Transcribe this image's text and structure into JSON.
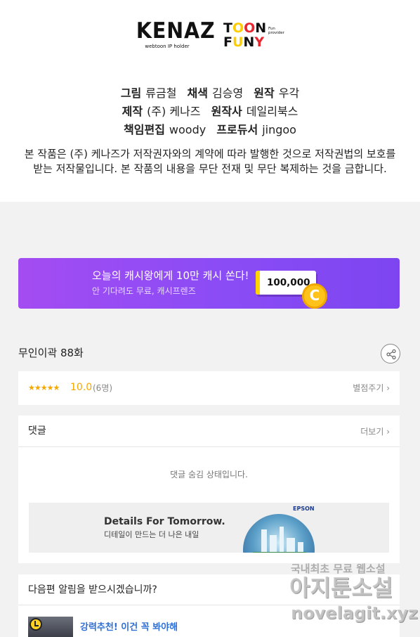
{
  "logos": {
    "kenaz": {
      "name": "KENAZ",
      "tagline": "webtoon IP holder"
    },
    "toonfuny": {
      "row1": "TOON",
      "row2": "FUNY",
      "tagline": "Fun provider"
    }
  },
  "credits": {
    "line1": [
      {
        "key": "그림",
        "value": "류금철"
      },
      {
        "key": "채색",
        "value": "김승영"
      },
      {
        "key": "원작",
        "value": "우각"
      }
    ],
    "line2": [
      {
        "key": "제작",
        "value": "(주) 케나즈"
      },
      {
        "key": "원작사",
        "value": "데일리북스"
      }
    ],
    "line3": [
      {
        "key": "책임편집",
        "value": "woody"
      },
      {
        "key": "프로듀서",
        "value": "jingoo"
      }
    ],
    "notice_line1": "본 작품은 (주) 케나즈가 저작권자와의 계약에 따라 발행한 것으로 저작권법의 보호를",
    "notice_line2": "받는 저작물입니다. 본 작품의 내용을 무단 전재 및 무단 복제하는 것을 금합니다."
  },
  "banner": {
    "title": "오늘의 캐시왕에게 10만 캐시 쏜다!",
    "subtitle": "안 기다려도 무료, 캐시프렌즈",
    "amount": "100,000",
    "coin_letter": "C",
    "colors": {
      "start": "#a34cf2",
      "end": "#7d45f0",
      "accent": "#ffd400"
    }
  },
  "episode": {
    "title": "무인이곽 88화",
    "share_icon": "share-icon"
  },
  "rating": {
    "stars": "★★★★★",
    "score": "10.0",
    "count": "(6명)",
    "give_label": "별점주기 ›",
    "accent_color": "#f5a800"
  },
  "comments": {
    "title": "댓글",
    "more_label": "더보기 ›",
    "hidden_message": "댓글 숨김 상태입니다."
  },
  "ad": {
    "brand": "EPSON",
    "headline": "Details For Tomorrow.",
    "tagline": "디테일이 만드는 더 나은 내일"
  },
  "notify": {
    "question": "다음편 알림을 받으시겠습니까?",
    "recommend": "강력추천! 이건 꼭 봐야해",
    "link_color": "#2f6fd6"
  },
  "watermark": {
    "line1": "국내최초 무료 웹소설",
    "line2": "아지툰소설",
    "line3": "novelagit.xyz"
  }
}
